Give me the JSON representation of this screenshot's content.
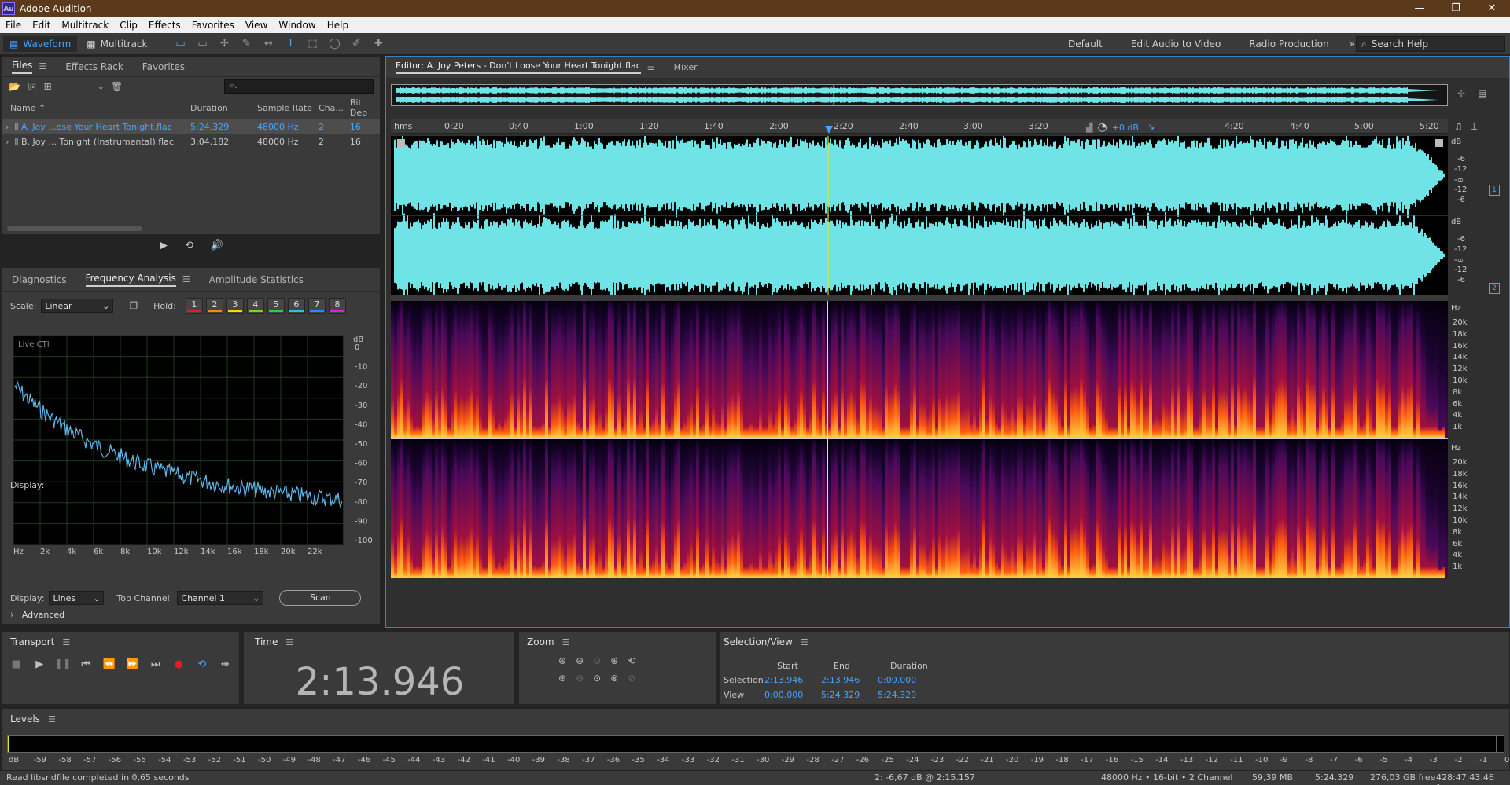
{
  "app": {
    "title": "Adobe Audition",
    "logo": "Au"
  },
  "window_controls": [
    "—",
    "❐",
    "✕"
  ],
  "menu": [
    "File",
    "Edit",
    "Multitrack",
    "Clip",
    "Effects",
    "Favorites",
    "View",
    "Window",
    "Help"
  ],
  "toolbar": {
    "waveform_label": "Waveform",
    "multitrack_label": "Multitrack",
    "workspaces": [
      "Default",
      "Edit Audio to Video",
      "Radio Production"
    ],
    "more": "»",
    "search_placeholder": "Search Help"
  },
  "files_panel": {
    "tabs": [
      "Files",
      "Effects Rack",
      "Favorites"
    ],
    "columns": [
      "Name ↑",
      "Duration",
      "Sample Rate",
      "Cha...",
      "Bit Dep"
    ],
    "rows": [
      {
        "name": "A. Joy ...ose Your Heart Tonight.flac",
        "duration": "5:24.329",
        "sample_rate": "48000 Hz",
        "channels": "2",
        "bit_depth": "16",
        "selected": true
      },
      {
        "name": "B. Joy ... Tonight (Instrumental).flac",
        "duration": "3:04.182",
        "sample_rate": "48000 Hz",
        "channels": "2",
        "bit_depth": "16",
        "selected": false
      }
    ]
  },
  "analysis_panel": {
    "tabs": [
      "Diagnostics",
      "Frequency Analysis",
      "Amplitude Statistics"
    ],
    "scale_label": "Scale:",
    "scale_value": "Linear",
    "hold_label": "Hold:",
    "hold_buttons": [
      "1",
      "2",
      "3",
      "4",
      "5",
      "6",
      "7",
      "8"
    ],
    "hold_colors": [
      "#e01e1e",
      "#ff8a00",
      "#ffd800",
      "#7ed321",
      "#2ecc40",
      "#22c9d6",
      "#1e90ff",
      "#e020e0"
    ],
    "graph_label": "Live CTI",
    "db_label": "dB",
    "db_ticks": [
      "0",
      "-10",
      "-20",
      "-30",
      "-40",
      "-50",
      "-60",
      "-70",
      "-80",
      "-90",
      "-100"
    ],
    "freq_ticks": [
      "Hz",
      "2k",
      "4k",
      "6k",
      "8k",
      "10k",
      "12k",
      "14k",
      "16k",
      "18k",
      "20k",
      "22k"
    ],
    "display_label": "Display:",
    "display_value": "Lines",
    "top_channel_label": "Top Channel:",
    "top_channel_value": "Channel 1",
    "scan_label": "Scan",
    "advanced_label": "Advanced"
  },
  "editor": {
    "tab_label": "Editor: A. Joy Peters - Don't Loose Your Heart Tonight.flac",
    "mixer_label": "Mixer",
    "ruler_unit": "hms",
    "ruler_ticks": [
      "0:20",
      "0:40",
      "1:00",
      "1:20",
      "1:40",
      "2:00",
      "2:20",
      "2:40",
      "3:00",
      "3:20",
      "4:20",
      "4:40",
      "5:00",
      "5:20"
    ],
    "hud_volume": "+0 dB",
    "db_label": "dB",
    "db_ticks": [
      "-6",
      "-12",
      "-∞",
      "-12",
      "-6"
    ],
    "channels": [
      "1",
      "2"
    ],
    "hz_label": "Hz",
    "hz_ticks": [
      "20k",
      "18k",
      "16k",
      "14k",
      "12k",
      "10k",
      "8k",
      "6k",
      "4k",
      "1k"
    ]
  },
  "transport": {
    "title": "Transport"
  },
  "time_panel": {
    "title": "Time",
    "value": "2:13.946"
  },
  "zoom_panel": {
    "title": "Zoom"
  },
  "selection_panel": {
    "title": "Selection/View",
    "headers": [
      "Start",
      "End",
      "Duration"
    ],
    "rows": [
      {
        "label": "Selection",
        "start": "2:13.946",
        "end": "2:13.946",
        "duration": "0:00.000"
      },
      {
        "label": "View",
        "start": "0:00.000",
        "end": "5:24.329",
        "duration": "5:24.329"
      }
    ]
  },
  "levels": {
    "title": "Levels",
    "ticks": [
      "dB",
      "-59",
      "-58",
      "-57",
      "-56",
      "-55",
      "-54",
      "-53",
      "-52",
      "-51",
      "-50",
      "-49",
      "-48",
      "-47",
      "-46",
      "-45",
      "-44",
      "-43",
      "-42",
      "-41",
      "-40",
      "-39",
      "-38",
      "-37",
      "-36",
      "-35",
      "-34",
      "-33",
      "-32",
      "-31",
      "-30",
      "-29",
      "-28",
      "-27",
      "-26",
      "-25",
      "-24",
      "-23",
      "-22",
      "-21",
      "-20",
      "-19",
      "-18",
      "-17",
      "-16",
      "-15",
      "-14",
      "-13",
      "-12",
      "-11",
      "-10",
      "-9",
      "-8",
      "-7",
      "-6",
      "-5",
      "-4",
      "-3",
      "-2",
      "-1",
      "0"
    ]
  },
  "status": {
    "left": "Read libsndfile completed in 0,65 seconds",
    "cursor": "2: -6,67 dB @ 2:15.157",
    "format": "48000 Hz • 16-bit • 2 Channel",
    "size": "59,39 MB",
    "duration": "5:24.329",
    "free": "276,03 GB free",
    "free_time": "428:47:43.46 free"
  },
  "colors": {
    "accent": "#4aa3ff",
    "waveform": "#6fe3e6",
    "playhead": "#e6e600"
  }
}
